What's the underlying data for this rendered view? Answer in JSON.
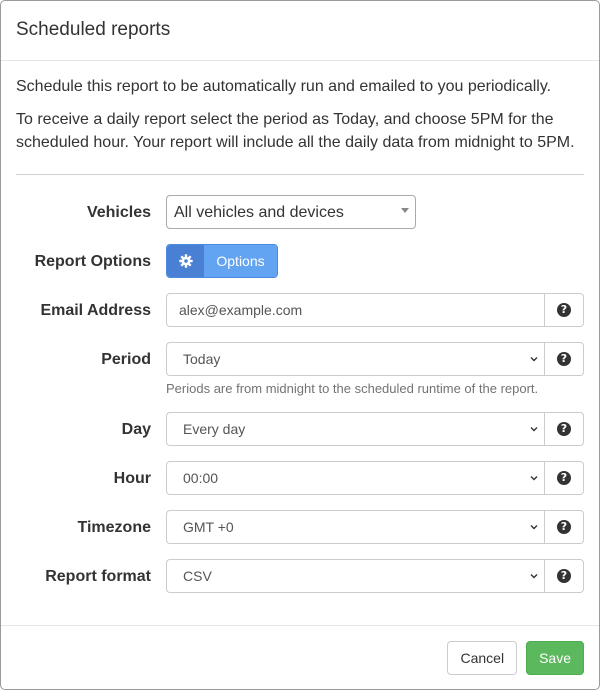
{
  "modal": {
    "title": "Scheduled reports"
  },
  "intro": {
    "line1": "Schedule this report to be automatically run and emailed to you periodically.",
    "line2": "To receive a daily report select the period as Today, and choose 5PM for the scheduled hour. Your report will include all the daily data from midnight to 5PM."
  },
  "form": {
    "vehicles": {
      "label": "Vehicles",
      "value": "All vehicles and devices"
    },
    "report_options": {
      "label": "Report Options",
      "button_label": "Options",
      "icon": "gear-icon"
    },
    "email": {
      "label": "Email Address",
      "value": "alex@example.com"
    },
    "period": {
      "label": "Period",
      "value": "Today",
      "help": "Periods are from midnight to the scheduled runtime of the report."
    },
    "day": {
      "label": "Day",
      "value": "Every day"
    },
    "hour": {
      "label": "Hour",
      "value": "00:00"
    },
    "timezone": {
      "label": "Timezone",
      "value": "GMT +0"
    },
    "report_format": {
      "label": "Report format",
      "value": "CSV"
    },
    "help_icon": "?"
  },
  "footer": {
    "cancel_label": "Cancel",
    "save_label": "Save"
  },
  "colors": {
    "primary": "#62a4f2",
    "primary_dark": "#4a80d3",
    "success": "#5cb85c"
  }
}
